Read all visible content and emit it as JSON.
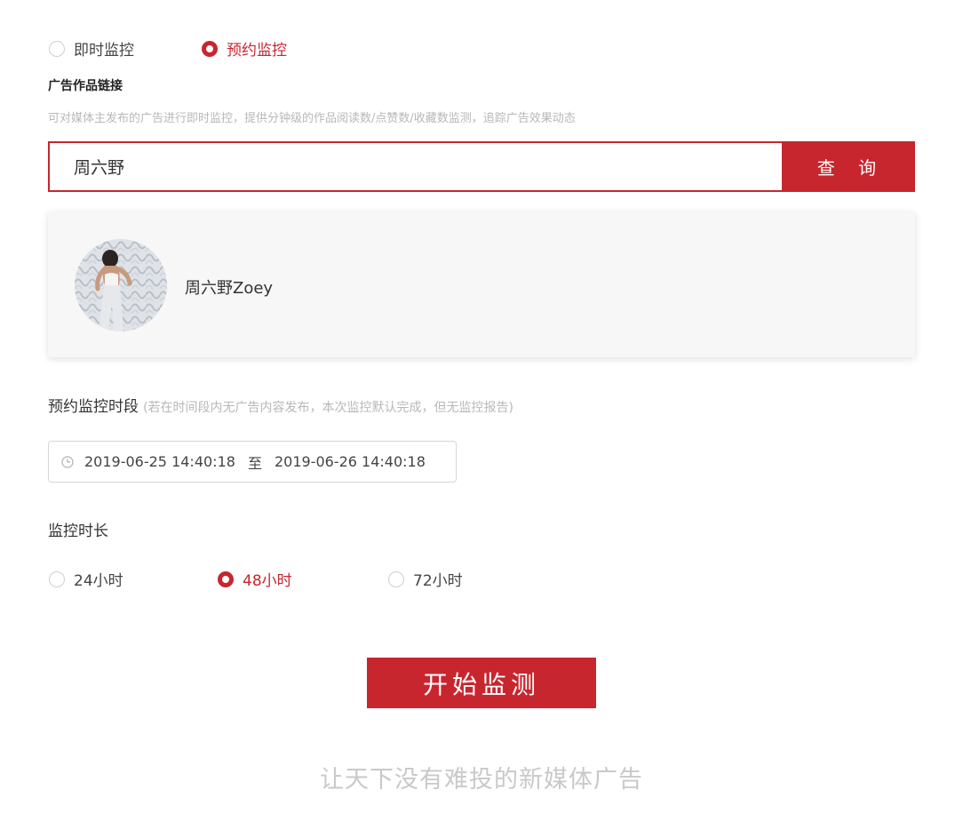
{
  "mode_options": {
    "instant_label": "即时监控",
    "scheduled_label": "预约监控",
    "selected": "scheduled"
  },
  "link_section": {
    "title": "广告作品链接",
    "hint": "可对媒体主发布的广告进行即时监控，提供分钟级的作品阅读数/点赞数/收藏数监测，追踪广告效果动态"
  },
  "search": {
    "value": "周六野",
    "button_label": "查 询"
  },
  "result": {
    "name": "周六野Zoey"
  },
  "schedule": {
    "label": "预约监控时段",
    "note": "(若在时间段内无广告内容发布，本次监控默认完成，但无监控报告)",
    "start": "2019-06-25 14:40:18",
    "separator": "至",
    "end": "2019-06-26 14:40:18"
  },
  "duration": {
    "label": "监控时长",
    "options": [
      "24小时",
      "48小时",
      "72小时"
    ],
    "selected": "48小时"
  },
  "start_button": "开始监测",
  "slogan": "让天下没有难投的新媒体广告",
  "colors": {
    "accent": "#c8262f",
    "muted": "#b8b8b8"
  }
}
